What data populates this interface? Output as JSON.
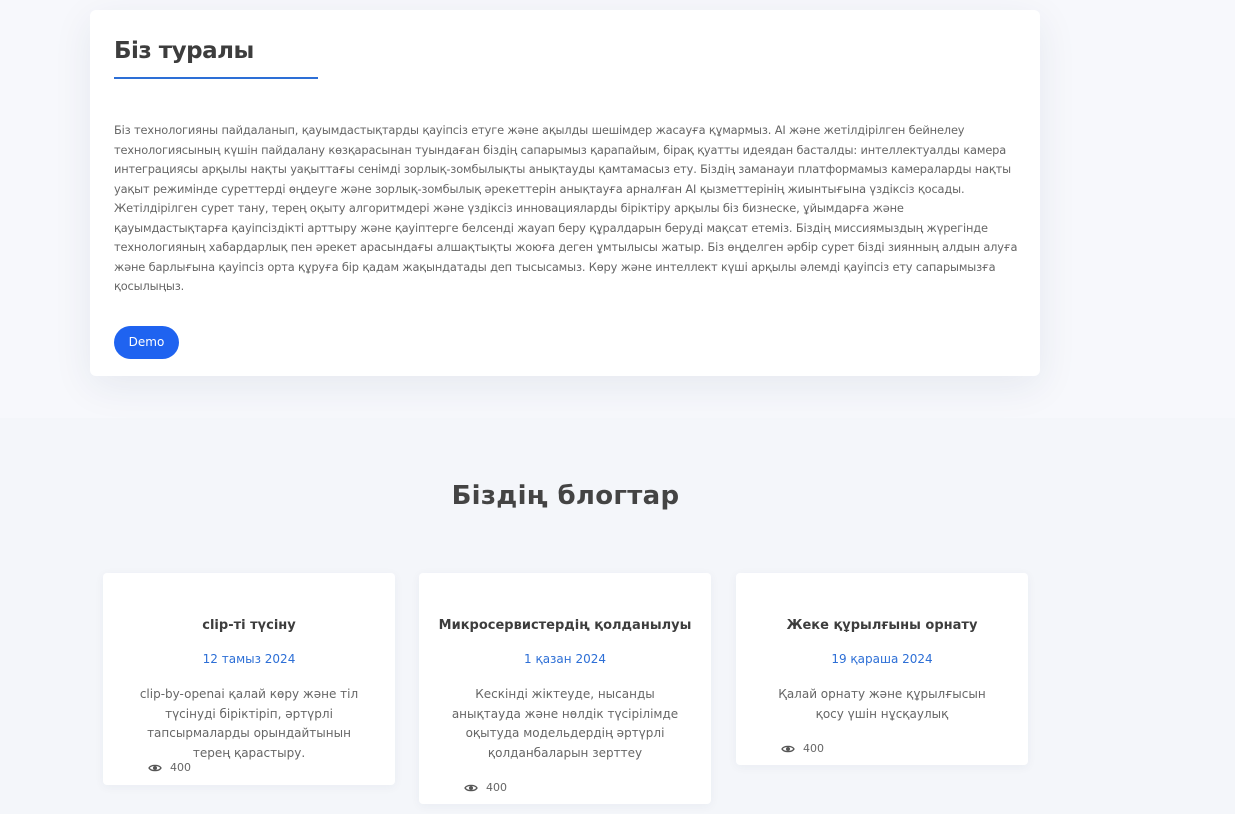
{
  "about": {
    "title": "Біз туралы",
    "text": "Біз технологияны пайдаланып, қауымдастықтарды қауіпсіз етуге және ақылды шешімдер жасауға құмармыз. AI және жетілдірілген бейнелеу технологиясының күшін пайдалану көзқарасынан туындаған біздің сапарымыз қарапайым, бірақ қуатты идеядан басталды: интеллектуалды камера интеграциясы арқылы нақты уақыттағы сенімді зорлық-зомбылықты анықтауды қамтамасыз ету. Біздің заманауи платформамыз камераларды нақты уақыт режимінде суреттерді өңдеуге және зорлық-зомбылық әрекеттерін анықтауға арналған AI қызметтерінің жиынтығына үздіксіз қосады. Жетілдірілген сурет тану, терең оқыту алгоритмдері және үздіксіз инновацияларды біріктіру арқылы біз бизнеске, ұйымдарға және қауымдастықтарға қауіпсіздікті арттыру және қауіптерге белсенді жауап беру құралдарын беруді мақсат етеміз. Біздің миссиямыздың жүрегінде технологияның хабардарлық пен әрекет арасындағы алшақтықты жоюға деген ұмтылысы жатыр. Біз өңделген әрбір сурет бізді зиянның алдын алуға және барлығына қауіпсіз орта құруға бір қадам жақындатады деп тысысамыз. Көру және интеллект күші арқылы әлемді қауіпсіз ету сапарымызға қосылыңыз.",
    "demo_label": "Demo"
  },
  "blogs": {
    "title": "Біздің блогтар",
    "items": [
      {
        "title": "clip-ті түсіну",
        "date": "12 тамыз 2024",
        "description": "clip-by-openai қалай көру және тіл түсінуді біріктіріп, әртүрлі тапсырмаларды орындайтынын терең қарастыру.",
        "views": "400"
      },
      {
        "title": "Микросервистердің қолданылуы",
        "date": "1 қазан 2024",
        "description": "Кескінді жіктеуде, нысанды анықтауда және нөлдік түсірілімде оқытуда модельдердің әртүрлі қолданбаларын зерттеу",
        "views": "400"
      },
      {
        "title": "Жеке құрылғыны орнату",
        "date": "19 қараша 2024",
        "description": "Қалай орнату және құрылғысын қосу үшін нұсқаулық",
        "views": "400"
      }
    ]
  },
  "colors": {
    "accent": "#2d6fd6",
    "button": "#1f63f0",
    "card": "#ffffff",
    "background": "#f4f6fa"
  },
  "icons": {
    "views": "eye-icon"
  }
}
